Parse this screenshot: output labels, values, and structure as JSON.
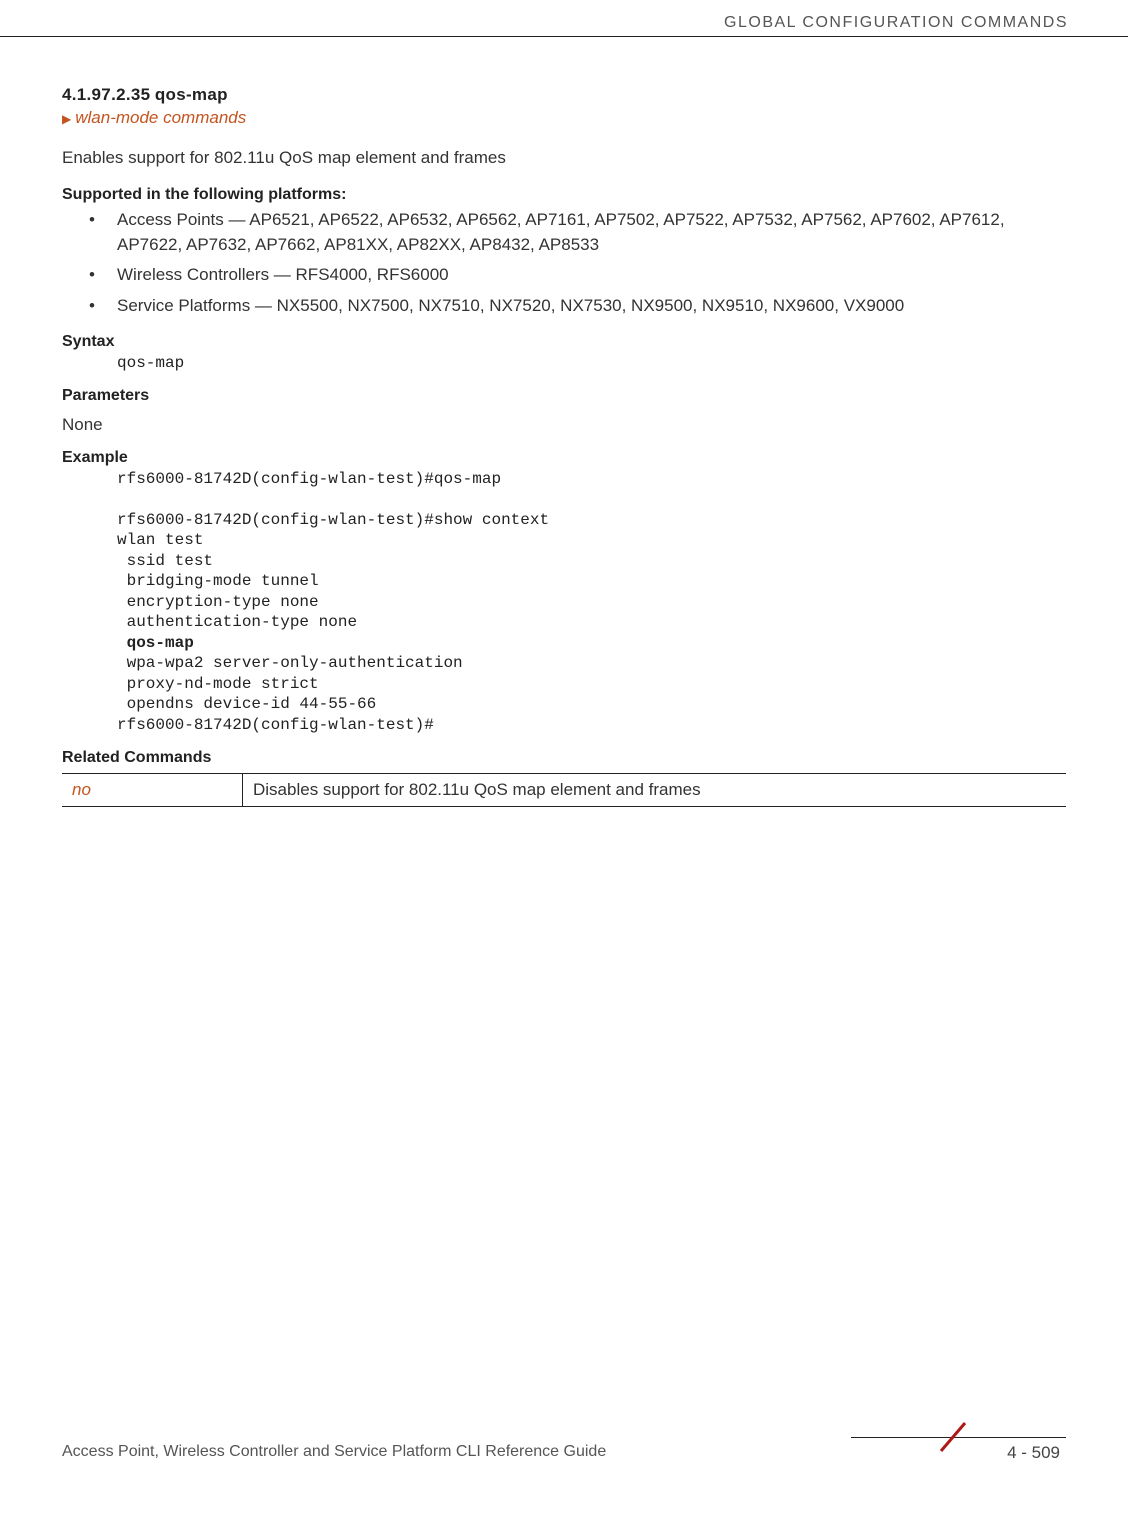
{
  "header": {
    "running": "GLOBAL CONFIGURATION COMMANDS"
  },
  "section": {
    "number": "4.1.97.2.35",
    "title": "qos-map",
    "navlink": "wlan-mode commands",
    "description": "Enables support for 802.11u QoS map element and frames"
  },
  "platforms": {
    "heading": "Supported in the following platforms:",
    "items": [
      "Access Points — AP6521, AP6522, AP6532, AP6562, AP7161, AP7502, AP7522, AP7532, AP7562, AP7602, AP7612, AP7622, AP7632, AP7662, AP81XX, AP82XX, AP8432, AP8533",
      "Wireless Controllers — RFS4000, RFS6000",
      "Service Platforms — NX5500, NX7500, NX7510, NX7520, NX7530, NX9500, NX9510, NX9600, VX9000"
    ]
  },
  "syntax": {
    "heading": "Syntax",
    "code": "qos-map"
  },
  "parameters": {
    "heading": "Parameters",
    "body": "None"
  },
  "example": {
    "heading": "Example",
    "line1": "rfs6000-81742D(config-wlan-test)#qos-map",
    "blank1": "",
    "line2": "rfs6000-81742D(config-wlan-test)#show context",
    "line3": "wlan test",
    "line4": " ssid test",
    "line5": " bridging-mode tunnel",
    "line6": " encryption-type none",
    "line7": " authentication-type none",
    "bold": " qos-map",
    "line8": " wpa-wpa2 server-only-authentication",
    "line9": " proxy-nd-mode strict",
    "line10": " opendns device-id 44-55-66",
    "line11": "rfs6000-81742D(config-wlan-test)#"
  },
  "related": {
    "heading": "Related Commands",
    "cmd": "no",
    "desc": "Disables support for 802.11u QoS map element and frames"
  },
  "footer": {
    "title": "Access Point, Wireless Controller and Service Platform CLI Reference Guide",
    "page": "4 - 509"
  }
}
